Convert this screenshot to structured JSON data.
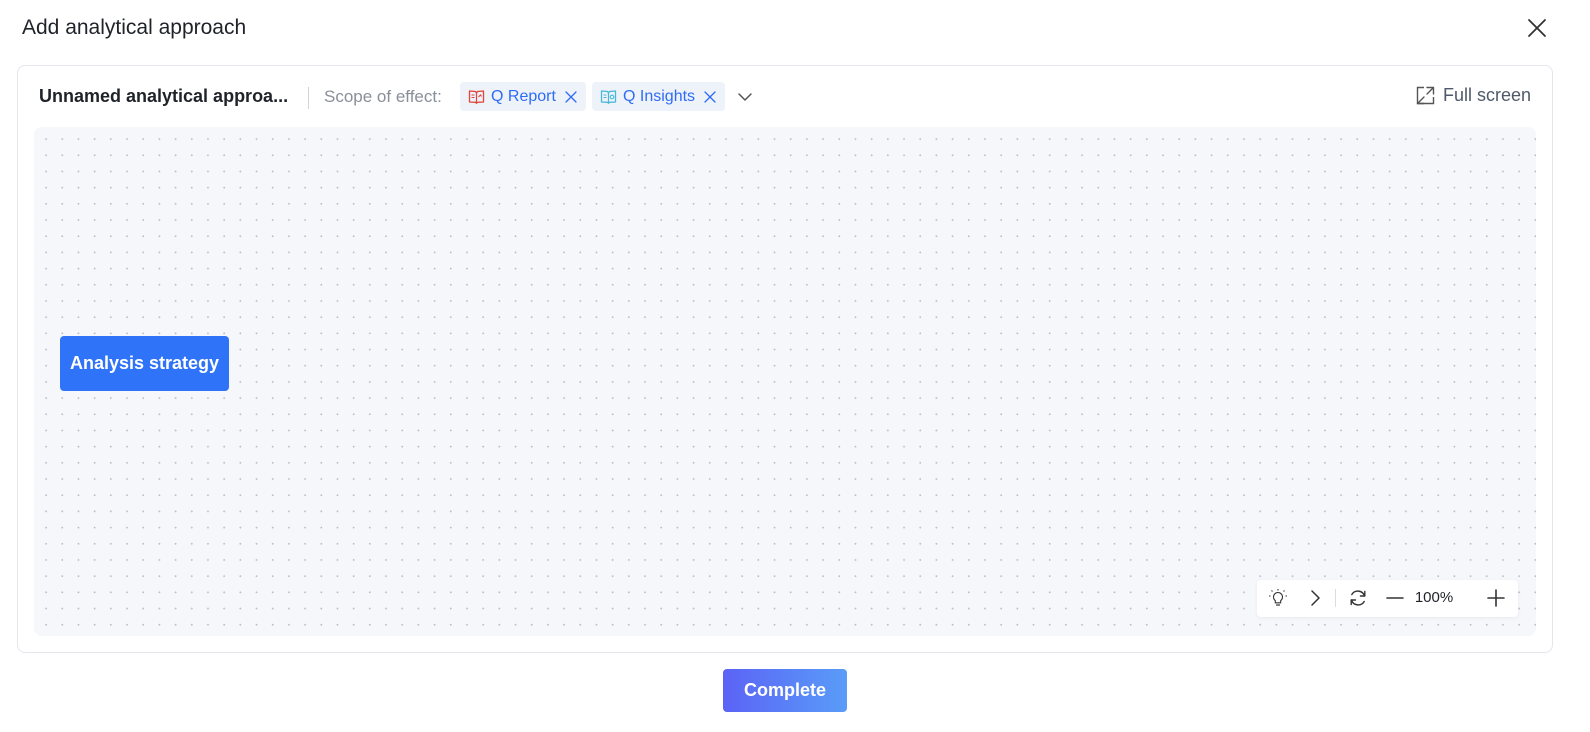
{
  "dialog": {
    "title": "Add analytical approach",
    "close_icon": "close-icon"
  },
  "toolbar": {
    "approach_name": "Unnamed analytical approa...",
    "scope_label": "Scope of effect:",
    "scope_tags": [
      {
        "label": "Q Report",
        "icon": "report-book-icon",
        "icon_color": "#e0443a"
      },
      {
        "label": "Q Insights",
        "icon": "insights-book-icon",
        "icon_color": "#46b8d8"
      }
    ],
    "dropdown_icon": "chevron-down-icon",
    "fullscreen_label": "Full screen",
    "fullscreen_icon": "expand-icon"
  },
  "canvas": {
    "node_label": "Analysis strategy",
    "node_color": "#2f74f8"
  },
  "zoom_controls": {
    "icons": [
      "lightbulb-icon",
      "chevron-right-icon",
      "refresh-icon",
      "minus-icon",
      "plus-icon"
    ],
    "zoom_value": "100%"
  },
  "footer": {
    "complete_label": "Complete"
  },
  "colors": {
    "accent": "#2f6cf6",
    "canvas_bg": "#f5f7fb"
  }
}
